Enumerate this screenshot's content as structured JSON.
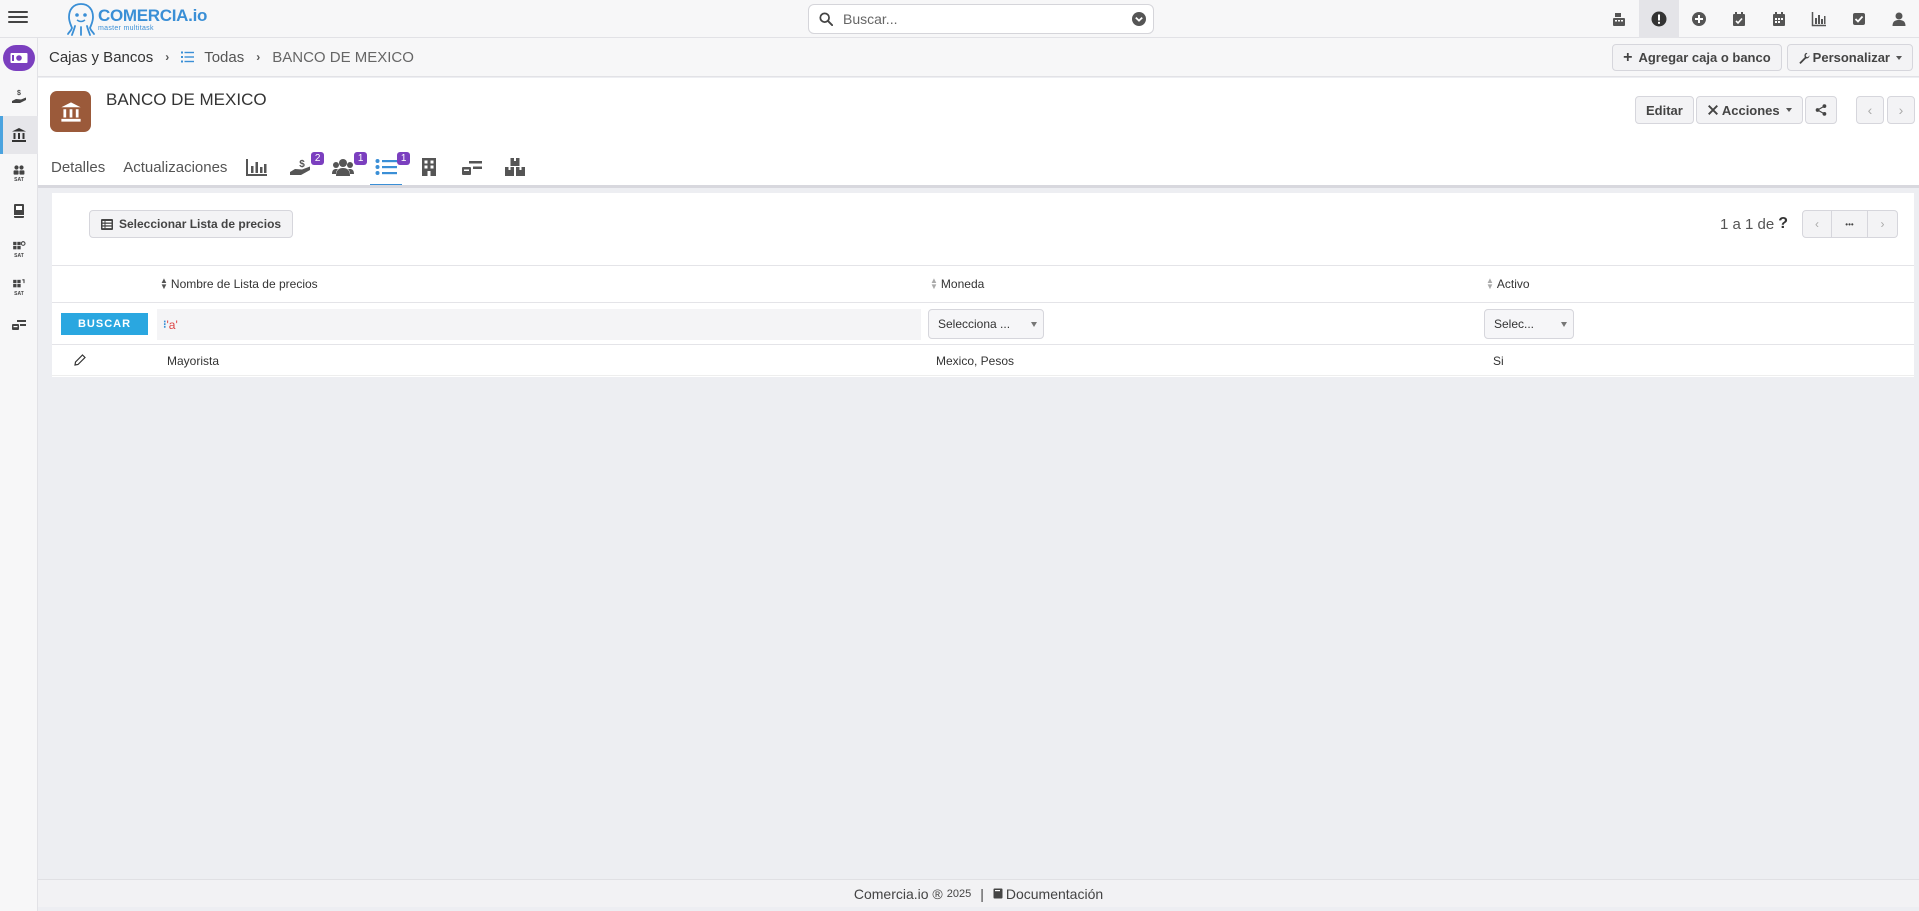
{
  "app": {
    "logo_name": "COMERCIA",
    "logo_suffix": ".io",
    "logo_tagline": "master multitask"
  },
  "search": {
    "placeholder": "Buscar..."
  },
  "top_icons": [
    "cash-register-icon",
    "alert-icon",
    "plus-circle-icon",
    "calendar-check-icon",
    "calendar-icon",
    "chart-icon",
    "check-square-icon",
    "user-icon"
  ],
  "sidebar": {
    "items": [
      {
        "name": "money-icon"
      },
      {
        "name": "hand-dollar-icon"
      },
      {
        "name": "bank-icon"
      },
      {
        "name": "sat-people-icon",
        "label": "SAT"
      },
      {
        "name": "book-icon"
      },
      {
        "name": "sat-settings-icon",
        "label": "SAT"
      },
      {
        "name": "sat-refresh-icon",
        "label": "SAT"
      },
      {
        "name": "transfer-icon"
      }
    ]
  },
  "breadcrumb": {
    "root": "Cajas y Bancos",
    "list": "Todas",
    "current": "BANCO DE MEXICO"
  },
  "crumb_actions": {
    "add": "Agregar caja o banco",
    "customize": "Personalizar"
  },
  "record": {
    "title": "BANCO DE MEXICO",
    "edit": "Editar",
    "actions": "Acciones"
  },
  "tabs": {
    "details": "Detalles",
    "updates": "Actualizaciones",
    "badge_payments": "2",
    "badge_people": "1",
    "badge_list": "1"
  },
  "panel": {
    "select_button": "Seleccionar Lista de precios",
    "pager_text": "1 a 1  de",
    "pager_help": "?",
    "pager_more": "•••"
  },
  "grid": {
    "columns": {
      "name": "Nombre de Lista de precios",
      "currency": "Moneda",
      "active": "Activo"
    },
    "filters": {
      "search_button": "BUSCAR",
      "name_filter_prefix": "⁝",
      "name_filter_value": "'a'",
      "currency_select": "Selecciona ...",
      "active_select": "Selec..."
    },
    "rows": [
      {
        "name": "Mayorista",
        "currency": "Mexico, Pesos",
        "active": "Si"
      }
    ]
  },
  "footer": {
    "brand": "Comercia.io ®",
    "year": "2025",
    "separator": "|",
    "docs": "Documentación"
  },
  "colors": {
    "accent_blue": "#3a8fd6",
    "badge_purple": "#7b3fbf",
    "bank_brown": "#9b5a3a",
    "buscar_blue": "#2aa7e0"
  }
}
